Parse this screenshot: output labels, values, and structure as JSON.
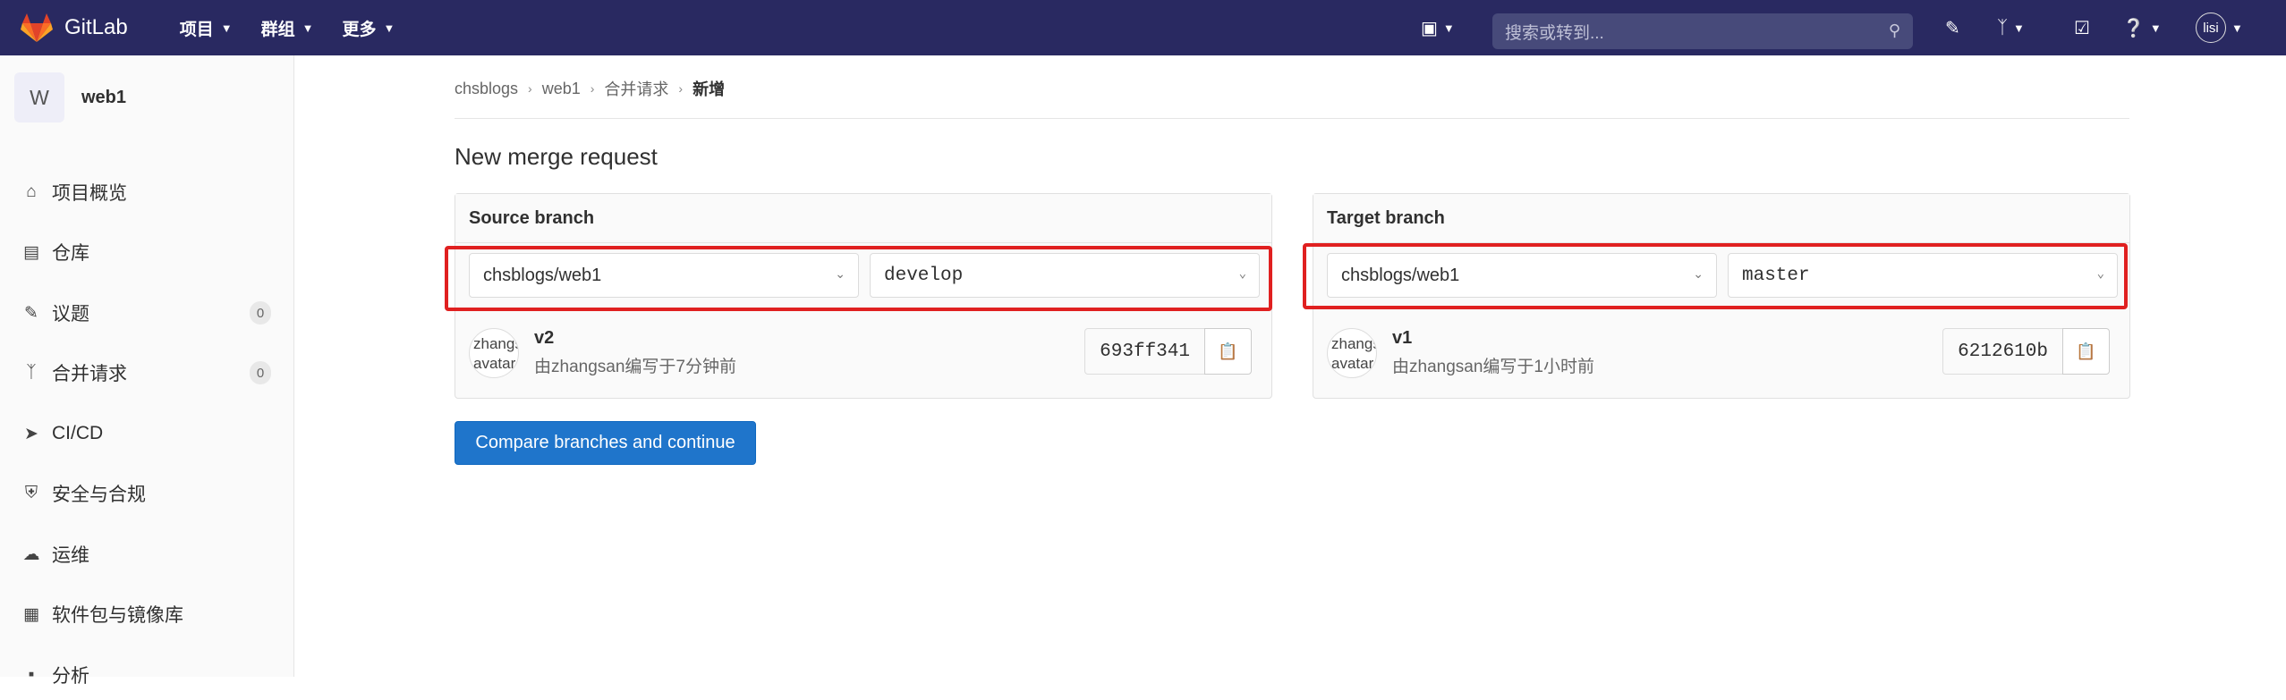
{
  "topbar": {
    "logo_text": "GitLab",
    "nav": [
      {
        "label": "项目"
      },
      {
        "label": "群组"
      },
      {
        "label": "更多"
      }
    ],
    "search_placeholder": "搜索或转到...",
    "user": "lisi",
    "brand_color": "#292961"
  },
  "sidebar": {
    "project_initial": "W",
    "project_name": "web1",
    "items": [
      {
        "label": "项目概览",
        "icon": "home-icon"
      },
      {
        "label": "仓库",
        "icon": "document-icon"
      },
      {
        "label": "议题",
        "icon": "issues-icon",
        "badge": "0"
      },
      {
        "label": "合并请求",
        "icon": "merge-request-icon",
        "badge": "0"
      },
      {
        "label": "CI/CD",
        "icon": "rocket-icon"
      },
      {
        "label": "安全与合规",
        "icon": "shield-icon"
      },
      {
        "label": "运维",
        "icon": "cloud-icon"
      },
      {
        "label": "软件包与镜像库",
        "icon": "package-icon"
      },
      {
        "label": "分析",
        "icon": "chart-icon"
      }
    ]
  },
  "breadcrumb": [
    "chsblogs",
    "web1",
    "合并请求",
    "新增"
  ],
  "page_title": "New merge request",
  "source": {
    "heading": "Source branch",
    "project": "chsblogs/web1",
    "branch": "develop",
    "commit": {
      "avatar_text": "zhangsan avatar",
      "title": "v2",
      "meta": "由zhangsan编写于7分钟前",
      "sha": "693ff341"
    }
  },
  "target": {
    "heading": "Target branch",
    "project": "chsblogs/web1",
    "branch": "master",
    "commit": {
      "avatar_text": "zhangsan avatar",
      "title": "v1",
      "meta": "由zhangsan编写于1小时前",
      "sha": "6212610b"
    }
  },
  "compare_button": "Compare branches and continue",
  "colors": {
    "primary": "#1f75cb",
    "highlight": "#e02020"
  }
}
